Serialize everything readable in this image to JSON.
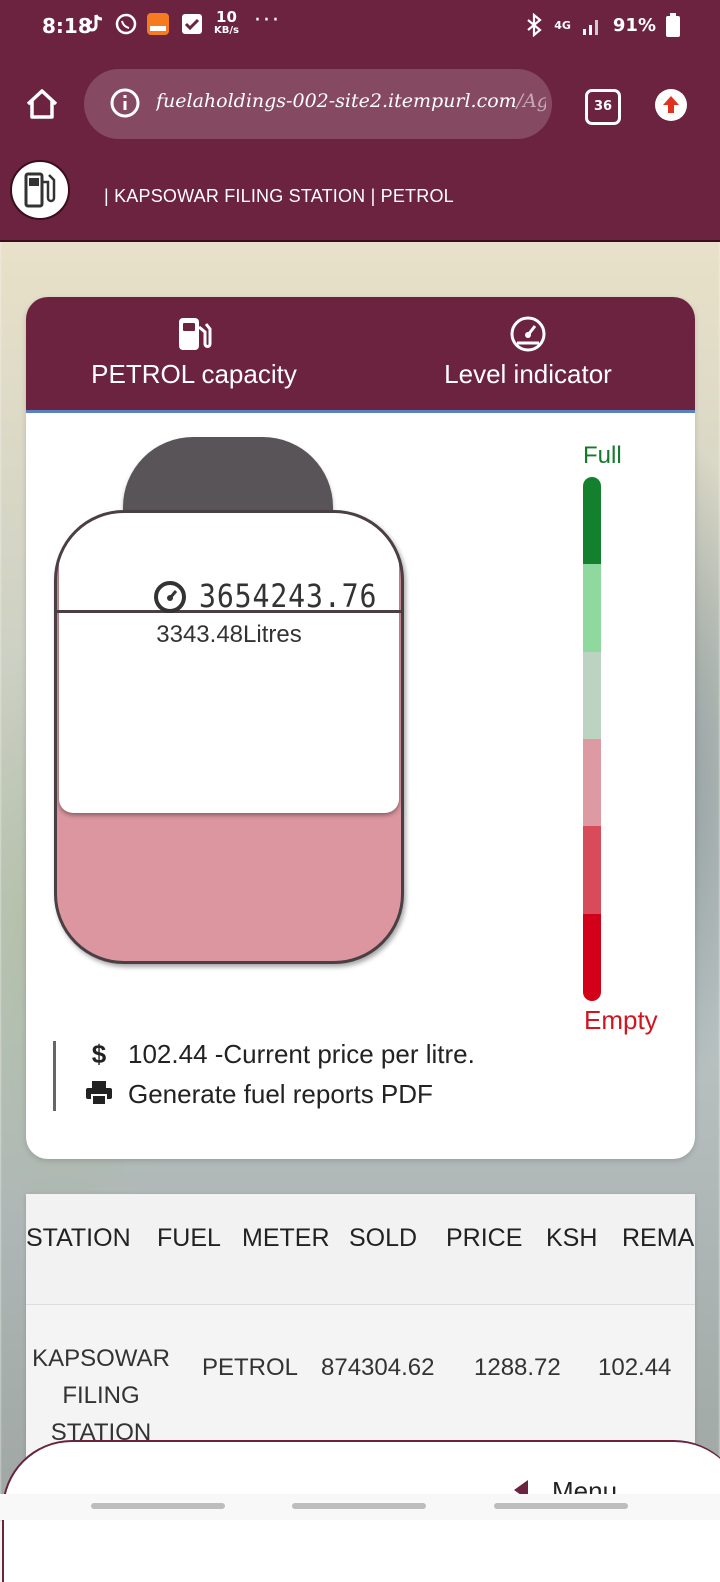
{
  "status_bar": {
    "time": "8:18",
    "network_speed": "10",
    "network_unit": "KB/s",
    "network_type": "4G",
    "battery": "91%"
  },
  "browser": {
    "url_domain": "fuelaholdings-002-site2.itempurl.com",
    "url_path": "/Agents/Dasl",
    "tab_count": "36"
  },
  "site": {
    "title": "| KAPSOWAR FILING STATION | PETROL"
  },
  "card": {
    "tabs": [
      {
        "label": "PETROL capacity",
        "icon": "fuel-pump-icon"
      },
      {
        "label": "Level indicator",
        "icon": "gauge-icon"
      }
    ],
    "tank": {
      "meter_reading": "3654243.76",
      "litres": "3343.48Litres",
      "fill_fraction": 0.33
    },
    "level": {
      "full_label": "Full",
      "empty_label": "Empty",
      "segments": [
        "#12802d",
        "#8fd99f",
        "#bcd3c2",
        "#de9aa2",
        "#d84b5b",
        "#d3001a"
      ]
    },
    "price_line": "102.44 -Current price per litre.",
    "report_line": "Generate fuel reports PDF"
  },
  "table": {
    "headers": [
      "STATION",
      "FUEL",
      "METER",
      "SOLD",
      "PRICE",
      "KSH",
      "REMAI"
    ],
    "row": {
      "station_lines": [
        "KAPSOWAR",
        "FILING",
        "STATION"
      ],
      "fuel": "PETROL",
      "meter": "874304.62",
      "sold": "1288.72",
      "price": "102.44"
    }
  },
  "bottom_sheet": {
    "menu_label": "Menu"
  },
  "colors": {
    "brand": "#6b2340",
    "accent_border": "#5a7fc4"
  }
}
